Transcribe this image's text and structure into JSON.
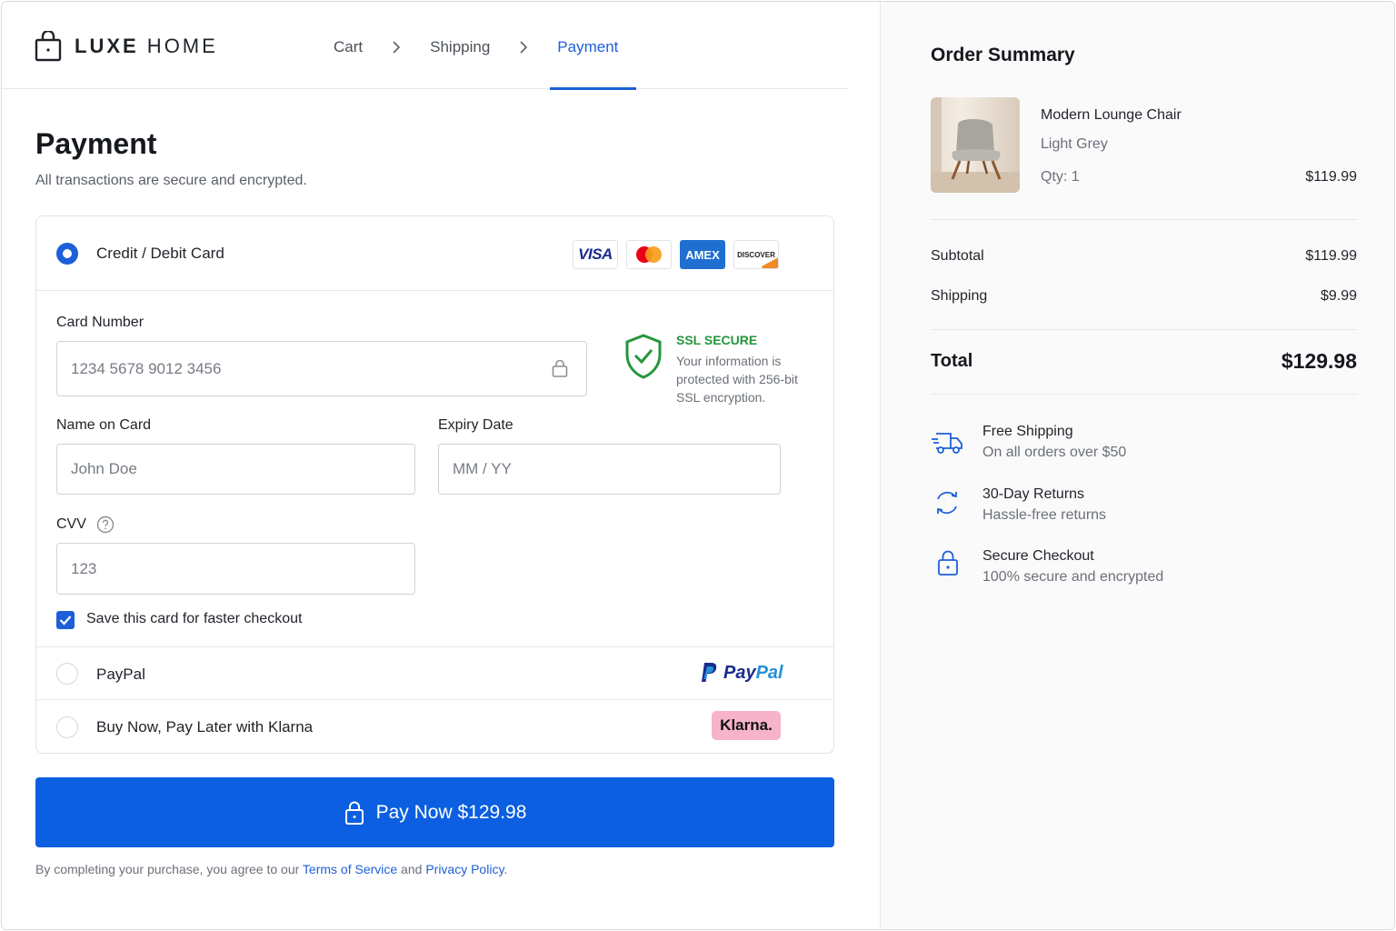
{
  "brand": {
    "name_bold": "LUXE",
    "name_light": " HOME"
  },
  "breadcrumb": {
    "items": [
      "Cart",
      "Shipping",
      "Payment"
    ],
    "active": "Payment"
  },
  "page": {
    "title": "Payment",
    "subtitle": "All transactions are secure and encrypted."
  },
  "methods": {
    "card": {
      "label": "Credit / Debit Card",
      "brands": [
        "VISA",
        "AMEX",
        "DISCOVER"
      ]
    },
    "paypal": {
      "label": "PayPal",
      "logo_a": "Pay",
      "logo_b": "Pal"
    },
    "klarna": {
      "label": "Buy Now, Pay Later with Klarna",
      "logo": "Klarna."
    }
  },
  "form": {
    "card_number": {
      "label": "Card Number",
      "placeholder": "1234 5678 9012 3456"
    },
    "name": {
      "label": "Name on Card",
      "placeholder": "John Doe"
    },
    "expiry": {
      "label": "Expiry Date",
      "placeholder": "MM / YY"
    },
    "cvv": {
      "label": "CVV",
      "placeholder": "123"
    },
    "save_card": {
      "label": "Save this card for faster checkout",
      "checked": true
    }
  },
  "ssl": {
    "title": "SSL SECURE",
    "text": "Your information is protected with 256-bit SSL encryption."
  },
  "pay_button": {
    "label": "Pay Now $129.98"
  },
  "terms": {
    "prefix": "By completing your purchase, you agree to our ",
    "tos": "Terms of Service",
    "and": " and ",
    "privacy": "Privacy Policy",
    "suffix": "."
  },
  "summary": {
    "title": "Order Summary",
    "item": {
      "name": "Modern Lounge Chair",
      "variant": "Light Grey",
      "qty": "Qty: 1",
      "price": "$119.99"
    },
    "subtotal": {
      "label": "Subtotal",
      "value": "$119.99"
    },
    "shipping": {
      "label": "Shipping",
      "value": "$9.99"
    },
    "total": {
      "label": "Total",
      "value": "$129.98"
    }
  },
  "perks": [
    {
      "title": "Free Shipping",
      "sub": "On all orders over $50"
    },
    {
      "title": "30-Day Returns",
      "sub": "Hassle-free returns"
    },
    {
      "title": "Secure Checkout",
      "sub": "100% secure and encrypted"
    }
  ],
  "colors": {
    "accent": "#1d5fd8",
    "button": "#0b5fe0",
    "ssl_green": "#25963a"
  }
}
